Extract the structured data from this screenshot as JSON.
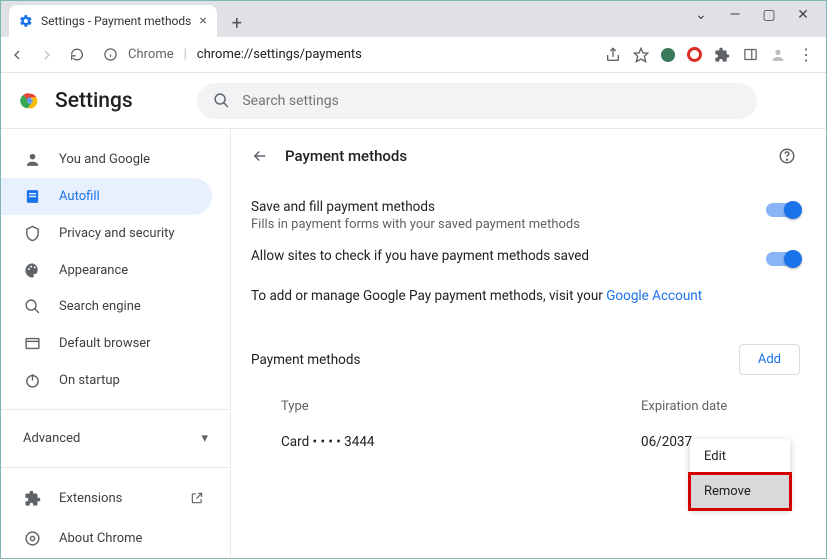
{
  "window": {
    "tab_title": "Settings - Payment methods"
  },
  "toolbar": {
    "url_label": "Chrome",
    "url_path": "chrome://settings/payments"
  },
  "app": {
    "title": "Settings",
    "search_placeholder": "Search settings"
  },
  "sidebar": {
    "items": [
      {
        "label": "You and Google"
      },
      {
        "label": "Autofill"
      },
      {
        "label": "Privacy and security"
      },
      {
        "label": "Appearance"
      },
      {
        "label": "Search engine"
      },
      {
        "label": "Default browser"
      },
      {
        "label": "On startup"
      }
    ],
    "advanced": "Advanced",
    "extensions": "Extensions",
    "about": "About Chrome"
  },
  "page": {
    "title": "Payment methods",
    "save_fill": {
      "title": "Save and fill payment methods",
      "sub": "Fills in payment forms with your saved payment methods"
    },
    "allow_check": {
      "title": "Allow sites to check if you have payment methods saved"
    },
    "google_pay_prefix": "To add or manage Google Pay payment methods, visit your ",
    "google_pay_link": "Google Account",
    "pm_header": "Payment methods",
    "add_label": "Add",
    "cols": {
      "type": "Type",
      "exp": "Expiration date"
    },
    "card": {
      "type": "Card • • • • 3444",
      "exp": "06/2037"
    },
    "menu": {
      "edit": "Edit",
      "remove": "Remove"
    }
  }
}
